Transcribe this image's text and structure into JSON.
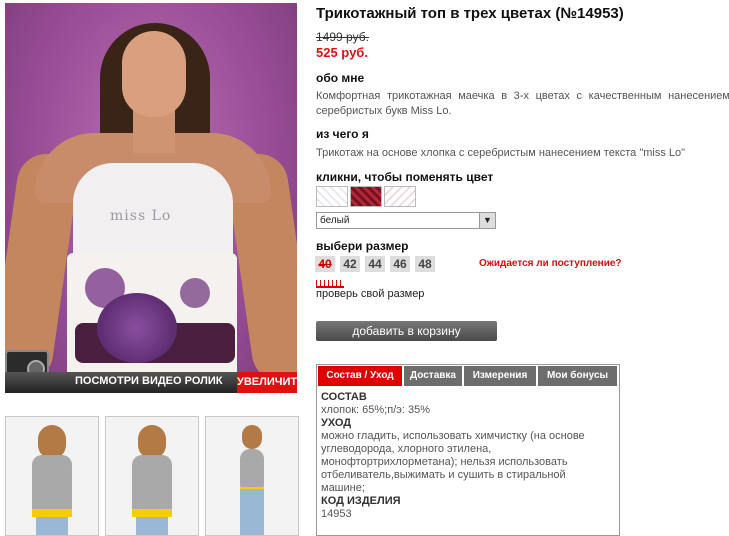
{
  "product": {
    "title": "Трикотажный топ в трех цветах (№14953)",
    "old_price": "1499 руб.",
    "new_price": "525 руб.",
    "photo_text": "miss Lo"
  },
  "about": {
    "heading": "обо мне",
    "text": "Комфортная трикотажная маечка в 3-х цветах с качественным нанесением серебристых букв Miss Lo."
  },
  "material": {
    "heading": "из чего я",
    "text": "Трикотаж на основе хлопка с серебристым нанесением текста \"miss Lo\""
  },
  "colors": {
    "heading": "кликни, чтобы поменять цвет",
    "selected": "белый",
    "swatch_colors": [
      "#ffffff",
      "#8b1a2b",
      "#f2dfe2"
    ]
  },
  "sizes": {
    "heading": "выбери размер",
    "items": [
      "40",
      "42",
      "44",
      "46",
      "48"
    ],
    "unavailable": [
      "40"
    ],
    "waiting_link": "Ожидается ли поступление?",
    "check_link": "проверь свой размер"
  },
  "cart_button": "добавить в корзину",
  "media": {
    "video_label": "ПОСМОТРИ ВИДЕО РОЛИК",
    "zoom_label": "УВЕЛИЧИТЬ"
  },
  "tabs": {
    "items": [
      "Состав / Уход",
      "Доставка",
      "Измерения",
      "Мои бонусы"
    ],
    "active": 0,
    "content": {
      "composition_h": "СОСТАВ",
      "composition": "хлопок: 65%;п/э: 35%",
      "care_h": "УХОД",
      "care": "можно гладить, использовать химчистку (на основе углеводорода, хлорного этилена, монофтортрихлорметана); нельзя использовать отбеливатель,выжимать и сушить в стиральной машине;",
      "code_h": "КОД ИЗДЕЛИЯ",
      "code": "14953"
    }
  },
  "colors_theme": {
    "accent_red": "#e00000",
    "tab_grey": "#6d6d6d",
    "price_red": "#e01010"
  }
}
